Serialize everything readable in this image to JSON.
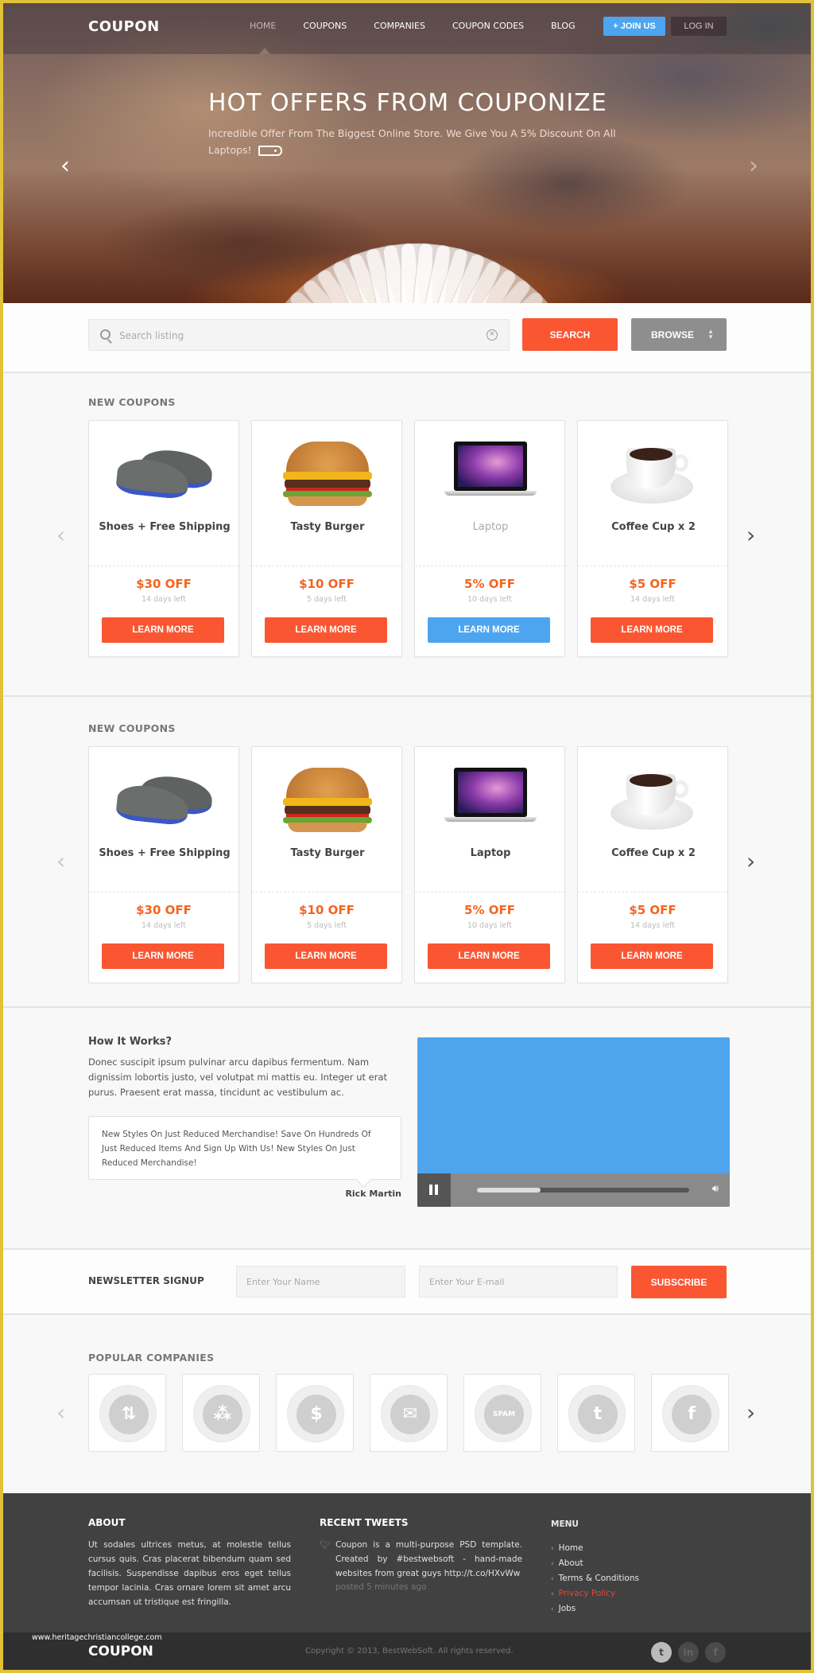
{
  "header": {
    "logo": "COUPON",
    "nav": [
      {
        "label": "HOME",
        "active": true
      },
      {
        "label": "COUPONS",
        "active": false
      },
      {
        "label": "COMPANIES",
        "active": false
      },
      {
        "label": "COUPON CODES",
        "active": false
      },
      {
        "label": "BLOG",
        "active": false
      }
    ],
    "join_label": "+ JOIN US",
    "login_label": "LOG IN"
  },
  "hero": {
    "title": "HOT OFFERS FROM COUPONIZE",
    "subtitle": "Incredible Offer From The Biggest Online Store. We Give You A 5% Discount On All Laptops!",
    "prev_icon": "‹",
    "next_icon": "›"
  },
  "search": {
    "placeholder": "Search listing",
    "value": "",
    "search_label": "SEARCH",
    "browse_label": "BROWSE"
  },
  "coupon_sections": [
    {
      "title": "NEW COUPONS",
      "items": [
        {
          "name": "Shoes + Free Shipping",
          "discount": "$30 OFF",
          "days_left": "14 days left",
          "button": "LEARN MORE",
          "image": "shoes",
          "highlighted": false
        },
        {
          "name": "Tasty Burger",
          "discount": "$10 OFF",
          "days_left": "5 days left",
          "button": "LEARN MORE",
          "image": "burger",
          "highlighted": false
        },
        {
          "name": "Laptop",
          "discount": "5% OFF",
          "days_left": "10 days left",
          "button": "LEARN MORE",
          "image": "laptop",
          "highlighted": true
        },
        {
          "name": "Coffee Cup x 2",
          "discount": "$5 OFF",
          "days_left": "14 days left",
          "button": "LEARN MORE",
          "image": "coffee",
          "highlighted": false
        }
      ]
    },
    {
      "title": "NEW COUPONS",
      "items": [
        {
          "name": "Shoes + Free Shipping",
          "discount": "$30 OFF",
          "days_left": "14 days left",
          "button": "LEARN MORE",
          "image": "shoes",
          "highlighted": false
        },
        {
          "name": "Tasty Burger",
          "discount": "$10 OFF",
          "days_left": "5 days left",
          "button": "LEARN MORE",
          "image": "burger",
          "highlighted": false
        },
        {
          "name": "Laptop",
          "discount": "5% OFF",
          "days_left": "10 days left",
          "button": "LEARN MORE",
          "image": "laptop",
          "highlighted": false
        },
        {
          "name": "Coffee Cup x 2",
          "discount": "$5 OFF",
          "days_left": "14 days left",
          "button": "LEARN MORE",
          "image": "coffee",
          "highlighted": false
        }
      ]
    }
  ],
  "how_it_works": {
    "title": "How It Works?",
    "text": "Donec suscipit ipsum pulvinar arcu dapibus fermentum. Nam dignissim lobortis justo, vel volutpat mi mattis eu. Integer ut erat purus. Praesent erat massa, tincidunt ac vestibulum ac.",
    "quote": "New Styles On Just Reduced Merchandise! Save On Hundreds Of Just Reduced Items And Sign Up With Us! New Styles On Just Reduced Merchandise!",
    "author": "Rick Martin",
    "video": {
      "state": "playing",
      "progress_percent": 30
    }
  },
  "newsletter": {
    "label": "NEWSLETTER SIGNUP",
    "name_placeholder": "Enter Your Name",
    "email_placeholder": "Enter Your E-mail",
    "button": "SUBSCRIBE"
  },
  "companies": {
    "title": "POPULAR COMPANIES",
    "items": [
      {
        "icon": "retweet-icon",
        "glyph": "⇅"
      },
      {
        "icon": "sitemap-icon",
        "glyph": "⁂"
      },
      {
        "icon": "dollar-icon",
        "glyph": "$"
      },
      {
        "icon": "mail-icon",
        "glyph": "✉"
      },
      {
        "icon": "spam-icon",
        "glyph": "SPAM"
      },
      {
        "icon": "twitter-icon",
        "glyph": "t"
      },
      {
        "icon": "facebook-icon",
        "glyph": "f"
      }
    ]
  },
  "footer": {
    "about_title": "ABOUT",
    "about_text": "Ut sodales ultrices metus, at molestie tellus cursus quis. Cras placerat bibendum quam sed facilisis. Suspendisse dapibus eros eget tellus tempor lacinia. Cras ornare lorem sit amet arcu accumsan ut tristique est fringilla.",
    "tweets_title": "RECENT TWEETS",
    "tweet_text": "Coupon is a multi-purpose PSD template. Created by #bestwebsoft - hand-made websites from great guys http://t.co/HXvWw",
    "tweet_time": "posted 5 minutes ago",
    "menu_title": "MENU",
    "menu": [
      {
        "label": "Home",
        "active": false
      },
      {
        "label": "About",
        "active": false
      },
      {
        "label": "Terms & Conditions",
        "active": false
      },
      {
        "label": "Privacy Policy",
        "active": true
      },
      {
        "label": "Jobs",
        "active": false
      }
    ],
    "logo": "COUPON",
    "copyright": "Copyright © 2013, BestWebSoft. All rights reserved.",
    "watermark": "www.heritagechristiancollege.com",
    "social": [
      {
        "name": "twitter",
        "glyph": "t",
        "active": true
      },
      {
        "name": "linkedin",
        "glyph": "in",
        "active": false
      },
      {
        "name": "facebook",
        "glyph": "f",
        "active": false
      }
    ]
  },
  "colors": {
    "accent_orange": "#fa5632",
    "accent_blue": "#4ea5ef",
    "discount_text": "#f26522",
    "footer_bg": "#414141"
  }
}
